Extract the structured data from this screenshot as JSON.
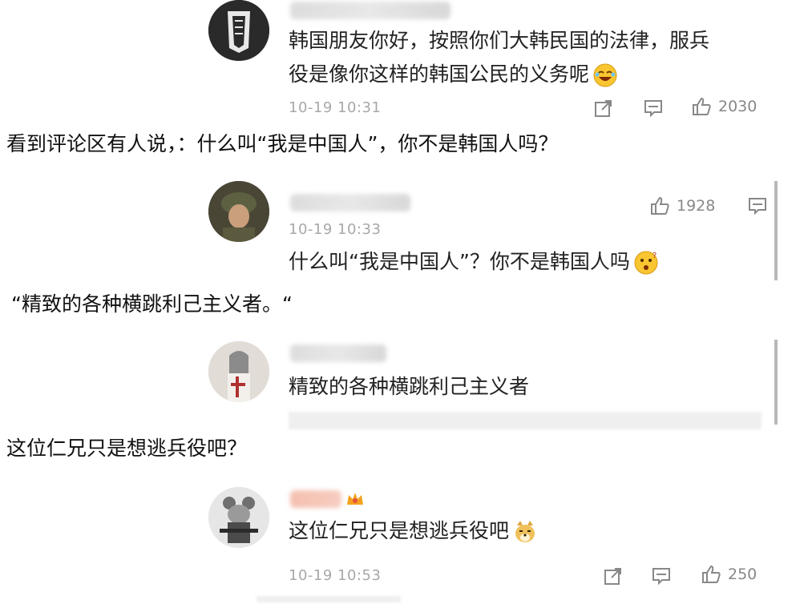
{
  "comments": [
    {
      "text_line1": "韩国朋友你好，按照你们大韩民国的法律，服兵",
      "text_line2": "役是像你这样的韩国公民的义务呢",
      "time": "10-19 10:31",
      "likes": "2030"
    },
    {
      "text": "什么叫“我是中国人”？你不是韩国人吗",
      "time": "10-19 10:33",
      "likes": "1928"
    },
    {
      "text": "精致的各种横跳利己主义者"
    },
    {
      "text": "这位仁兄只是想逃兵役吧",
      "time": "10-19 10:53",
      "likes": "250"
    }
  ],
  "captions": {
    "c1": "看到评论区有人说，：什么叫“我是中国人”，你不是韩国人吗？",
    "c2": "“精致的各种横跳利己主义者。“",
    "c3": "这位仁兄只是想逃兵役吧？"
  },
  "icons": {
    "share": "share-icon",
    "comment": "comment-icon",
    "like": "thumbs-up-icon"
  },
  "colors": {
    "meta_gray": "#a8a8a8",
    "text": "#222222",
    "divider": "#b8b8b8"
  }
}
